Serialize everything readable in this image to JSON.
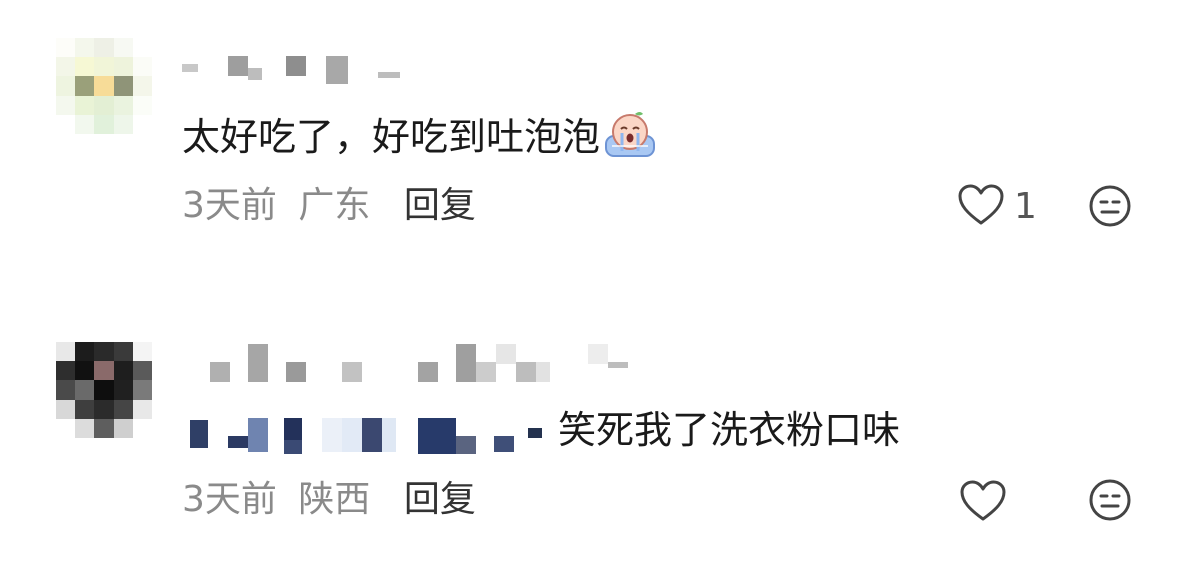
{
  "comments": [
    {
      "text": "太好吃了，好吃到吐泡泡",
      "emoji_icon": "crying-baby-emoji-icon",
      "time": "3天前",
      "location": "广东",
      "reply_label": "回复",
      "likes": "1"
    },
    {
      "text": "笑死我了洗衣粉口味",
      "time": "3天前",
      "location": "陕西",
      "reply_label": "回复",
      "likes": ""
    }
  ],
  "colors": {
    "meta_text": "#8a8a8a",
    "reply_text": "#333333",
    "body_text": "#1a1a1a",
    "icon_stroke": "#444444"
  }
}
